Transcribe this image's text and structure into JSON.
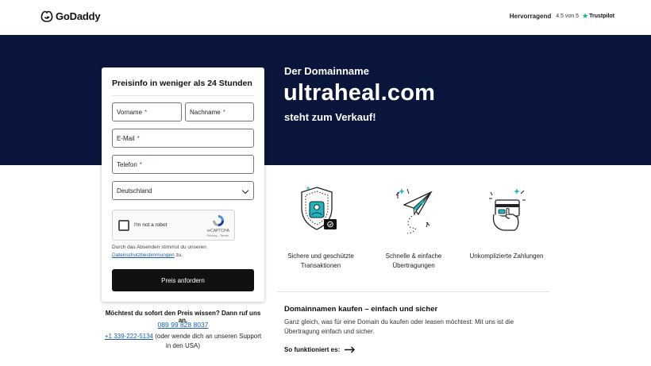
{
  "header": {
    "brand": "GoDaddy",
    "rating_word": "Hervorragend",
    "rating_score": "4.5 von 5",
    "trustpilot": "Trustpilot"
  },
  "hero": {
    "pre": "Der Domainname",
    "domain": "ultraheal.com",
    "post": "steht zum Verkauf!",
    "background": "#09153a"
  },
  "form": {
    "title": "Preisinfo in weniger als 24 Stunden",
    "first_name": "Vorname",
    "last_name": "Nachname",
    "email": "E-Mail",
    "phone": "Telefon",
    "required_mark": "*",
    "country": "Deutschland",
    "captcha_label": "I'm not a robot",
    "captcha_brand": "reCAPTCHA",
    "captcha_links": "Privacy - Terms",
    "consent_text": "Durch das Absenden stimmst du unseren",
    "consent_link": "Datenschutzbestimmungen",
    "consent_suffix": "zu.",
    "submit_label": "Preis anfordern"
  },
  "call": {
    "question": "Möchtest du sofort den Preis wissen? Dann ruf uns an.",
    "de_number": "089 99 828 8037",
    "us_number": "+1 339-222-5134",
    "us_text": " (oder wende dich an unseren Support in den USA)"
  },
  "features": [
    {
      "icon": "shield-icon",
      "label": "Sichere und geschützte Transaktionen"
    },
    {
      "icon": "paper-plane-icon",
      "label": "Schnelle & einfache Übertragungen"
    },
    {
      "icon": "payment-card-icon",
      "label": "Unkomplizierte Zahlungen"
    }
  ],
  "buy": {
    "title": "Domainnamen kaufen – einfach und sicher",
    "text": "Ganz gleich, was für eine Domain du kaufen oder leasen möchtest: Mit uns ist die Übertragung einfach und sicher.",
    "how_label": "So funktioniert es:"
  },
  "colors": {
    "accent": "#1a5fb4",
    "teal": "#1bb6c2",
    "trustpilot_green": "#00b67a"
  }
}
